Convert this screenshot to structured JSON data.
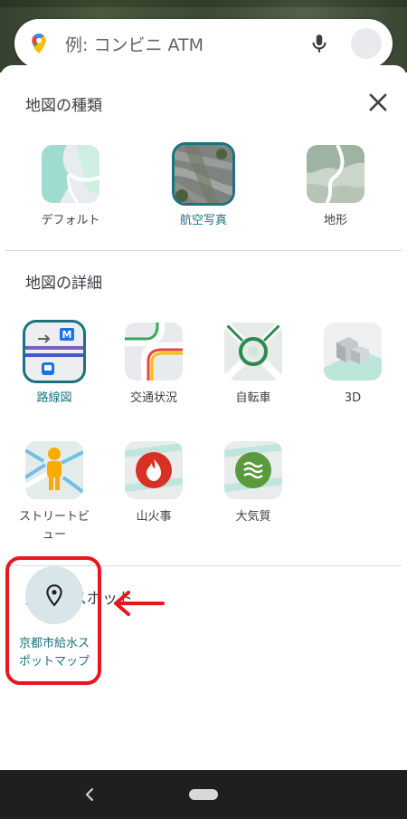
{
  "search": {
    "placeholder": "例: コンビニ ATM"
  },
  "sections": {
    "map_type": {
      "title": "地図の種類",
      "items": [
        {
          "label": "デフォルト",
          "selected": false
        },
        {
          "label": "航空写真",
          "selected": true
        },
        {
          "label": "地形",
          "selected": false
        }
      ]
    },
    "map_details": {
      "title": "地図の詳細",
      "items": [
        {
          "label": "路線図",
          "selected": true
        },
        {
          "label": "交通状況",
          "selected": false
        },
        {
          "label": "自転車",
          "selected": false
        },
        {
          "label": "3D",
          "selected": false
        },
        {
          "label": "ストリートビュー",
          "label_line1": "ストリートビ",
          "label_line2": "ュー",
          "selected": false
        },
        {
          "label": "山火事",
          "selected": false
        },
        {
          "label": "大気質",
          "selected": false
        }
      ]
    },
    "nearby_spots": {
      "title": "周辺のスポット",
      "items": [
        {
          "label": "京都市給水スポットマップ",
          "label_line1": "京都市給水ス",
          "label_line2": "ポットマップ"
        }
      ]
    }
  },
  "colors": {
    "accent": "#1a737e",
    "highlight": "#e8161e"
  }
}
